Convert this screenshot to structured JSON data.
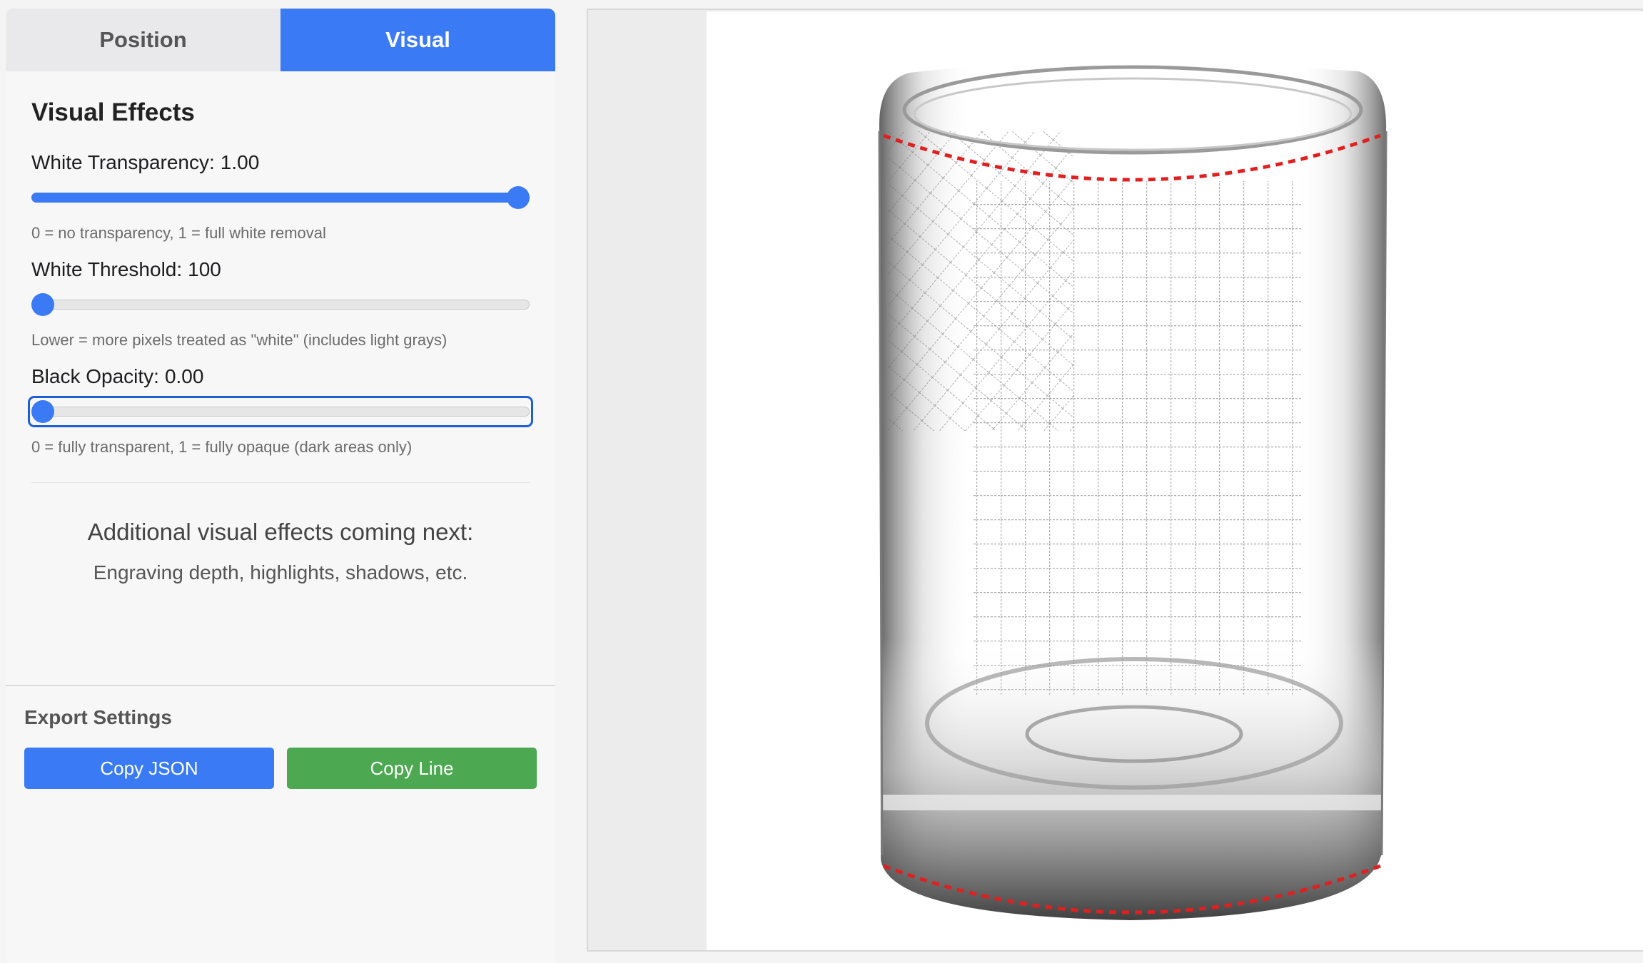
{
  "tabs": [
    {
      "label": "Position",
      "active": false
    },
    {
      "label": "Visual",
      "active": true
    }
  ],
  "visual_effects": {
    "title": "Visual Effects",
    "white_transparency": {
      "label": "White Transparency:",
      "value": "1.00",
      "fraction": 1.0,
      "hint": "0 = no transparency, 1 = full white removal"
    },
    "white_threshold": {
      "label": "White Threshold:",
      "value": "100",
      "fraction": 0.0,
      "hint": "Lower = more pixels treated as \"white\" (includes light grays)"
    },
    "black_opacity": {
      "label": "Black Opacity:",
      "value": "0.00",
      "fraction": 0.0,
      "hint": "0 = fully transparent, 1 = fully opaque (dark areas only)"
    },
    "coming_title": "Additional visual effects coming next:",
    "coming_sub": "Engraving depth, highlights, shadows, etc."
  },
  "export": {
    "title": "Export Settings",
    "copy_json_label": "Copy JSON",
    "copy_line_label": "Copy Line"
  },
  "colors": {
    "accent": "#3a7af4",
    "green": "#4ca851",
    "guide_line": "#e02020"
  },
  "preview": {
    "image": "engraved-rocks-glass-with-city-map",
    "guides": "red dashed top and bottom curve lines"
  }
}
